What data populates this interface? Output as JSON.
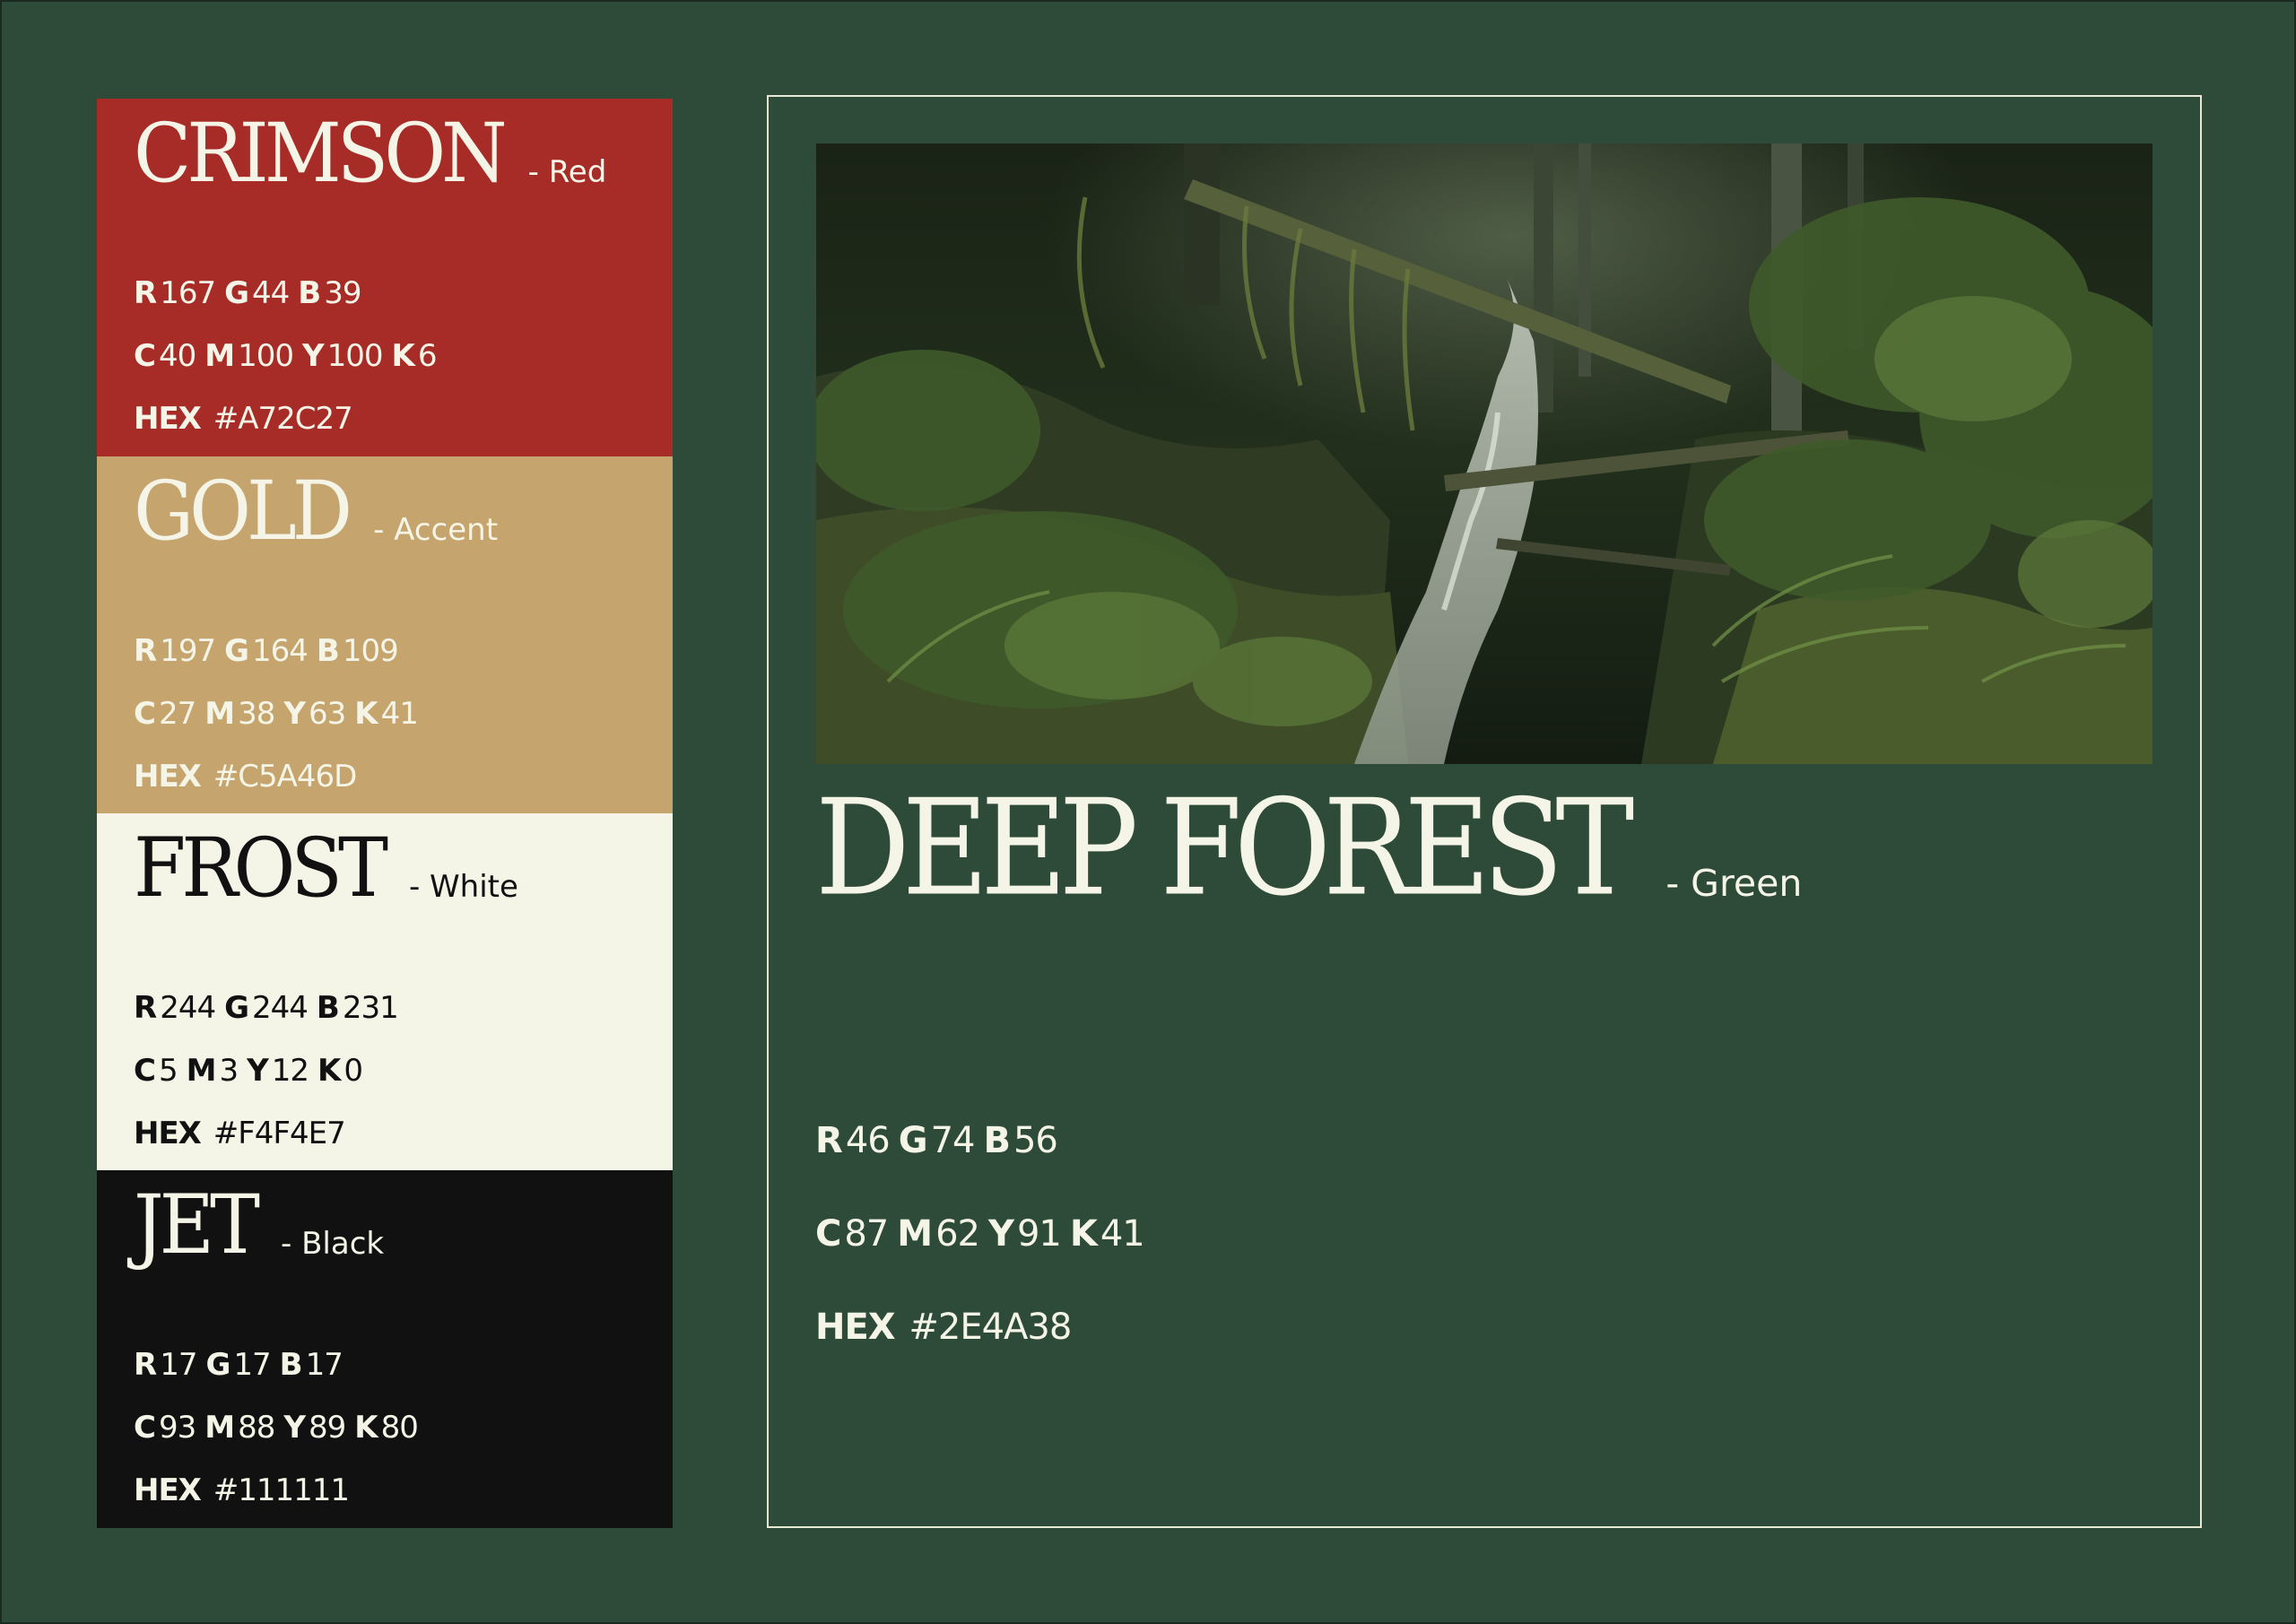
{
  "swatches": [
    {
      "name": "CRIMSON",
      "role": "- Red",
      "bg": "#A72C27",
      "fg": "#F4F4E7",
      "rgb": {
        "r": "167",
        "g": "44",
        "b": "39"
      },
      "cmyk": {
        "c": "40",
        "m": "100",
        "y": "100",
        "k": "6"
      },
      "hex": "#A72C27"
    },
    {
      "name": "GOLD",
      "role": "- Accent",
      "bg": "#C5A46D",
      "fg": "#F4F4E7",
      "rgb": {
        "r": "197",
        "g": "164",
        "b": "109"
      },
      "cmyk": {
        "c": "27",
        "m": "38",
        "y": "63",
        "k": "41"
      },
      "hex": "#C5A46D"
    },
    {
      "name": "FROST",
      "role": "- White",
      "bg": "#F4F4E7",
      "fg": "#111111",
      "rgb": {
        "r": "244",
        "g": "244",
        "b": "231"
      },
      "cmyk": {
        "c": "5",
        "m": "3",
        "y": "12",
        "k": "0"
      },
      "hex": "#F4F4E7"
    },
    {
      "name": "JET",
      "role": "- Black",
      "bg": "#111111",
      "fg": "#F4F4E7",
      "rgb": {
        "r": "17",
        "g": "17",
        "b": "17"
      },
      "cmyk": {
        "c": "93",
        "m": "88",
        "y": "89",
        "k": "80"
      },
      "hex": "#111111"
    }
  ],
  "labels": {
    "r": "R",
    "g": "G",
    "b": "B",
    "c": "C",
    "m": "M",
    "y": "Y",
    "k": "K",
    "hex": "HEX"
  },
  "feature": {
    "name": "DEEP FOREST",
    "role": "- Green",
    "bg": "#2E4A38",
    "fg": "#F4F4E7",
    "rgb": {
      "r": "46",
      "g": "74",
      "b": "56"
    },
    "cmyk": {
      "c": "87",
      "m": "62",
      "y": "91",
      "k": "41"
    },
    "hex": "#2E4A38",
    "photo_icon": "forest-waterfall-photo"
  }
}
